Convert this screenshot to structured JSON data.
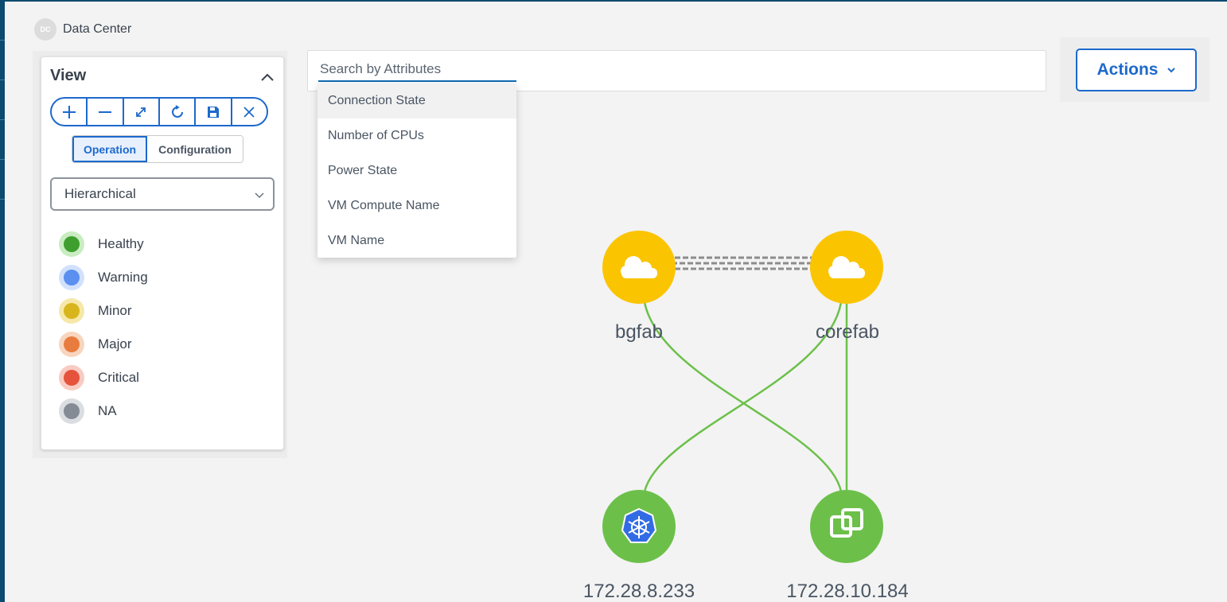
{
  "breadcrumb": {
    "avatar_text": "DC",
    "label": "Data Center"
  },
  "view_panel": {
    "title": "View",
    "toolbar": [
      {
        "name": "zoom-in-button",
        "icon": "plus-icon"
      },
      {
        "name": "zoom-out-button",
        "icon": "minus-icon"
      },
      {
        "name": "fit-button",
        "icon": "expand-icon"
      },
      {
        "name": "refresh-button",
        "icon": "refresh-icon"
      },
      {
        "name": "save-button",
        "icon": "save-icon"
      },
      {
        "name": "clear-button",
        "icon": "close-icon"
      }
    ],
    "mode_tabs": {
      "operation": "Operation",
      "configuration": "Configuration",
      "selected": "Operation"
    },
    "layout_select": {
      "value": "Hierarchical"
    },
    "legend": [
      {
        "label": "Healthy",
        "color": "#3f9f2e",
        "halo": "#c9ecc1"
      },
      {
        "label": "Warning",
        "color": "#5b8ff0",
        "halo": "#d2e1fb"
      },
      {
        "label": "Minor",
        "color": "#d8b51c",
        "halo": "#f5e8a8"
      },
      {
        "label": "Major",
        "color": "#e87c3e",
        "halo": "#f8d5bf"
      },
      {
        "label": "Critical",
        "color": "#e5533d",
        "halo": "#f8cbc3"
      },
      {
        "label": "NA",
        "color": "#858b94",
        "halo": "#dadde1"
      }
    ]
  },
  "search": {
    "placeholder": "Search by Attributes",
    "value": "",
    "options": [
      "Connection State",
      "Number of CPUs",
      "Power State",
      "VM Compute Name",
      "VM Name"
    ],
    "highlighted": "Connection State"
  },
  "actions": {
    "label": "Actions"
  },
  "topology": {
    "nodes": [
      {
        "id": "bgfab",
        "label": "bgfab",
        "type": "cloud",
        "color": "#fbc400"
      },
      {
        "id": "corefab",
        "label": "corefab",
        "type": "cloud",
        "color": "#fbc400"
      },
      {
        "id": "k8s",
        "label": "172.28.8.233",
        "type": "kubernetes",
        "color": "#6cc04a"
      },
      {
        "id": "vmware",
        "label": "172.28.10.184",
        "type": "vmware",
        "color": "#6cc04a"
      }
    ],
    "links": [
      {
        "from": "bgfab",
        "to": "corefab",
        "style": "dashed-bundle"
      },
      {
        "from": "bgfab",
        "to": "vmware",
        "style": "green"
      },
      {
        "from": "corefab",
        "to": "k8s",
        "style": "green"
      },
      {
        "from": "corefab",
        "to": "vmware",
        "style": "green"
      }
    ],
    "link_color": "#6cc04a"
  }
}
